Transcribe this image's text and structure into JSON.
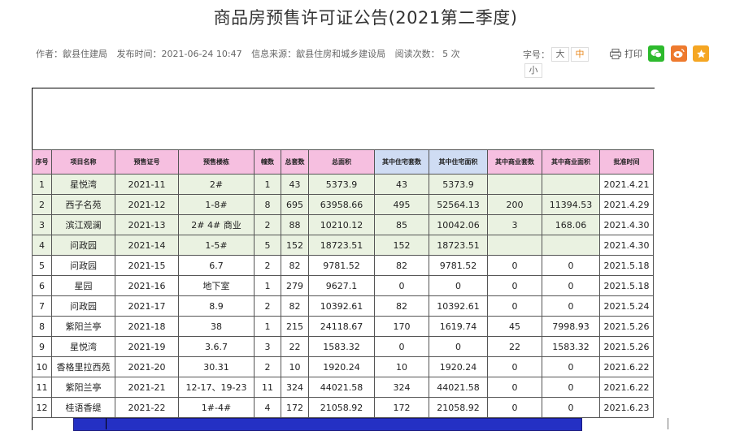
{
  "page": {
    "title": "商品房预售许可证公告(2021第二季度)",
    "meta": {
      "author": "作者：歙县住建局",
      "published": "发布时间：2021-06-24 10:47",
      "source": "信息来源：歙县住房和城乡建设局",
      "reads": "阅读次数： 5 次"
    },
    "font_size": {
      "label": "字号：",
      "large": "大",
      "medium": "中",
      "small": "小"
    },
    "print_label": "打印"
  },
  "colors": {
    "header_pink": "#f6bfe0",
    "header_blue": "#cfdcf3",
    "row_green": "#eaf2e1",
    "accent": "#e8861a"
  },
  "table": {
    "headers": [
      "序号",
      "项目名称",
      "预售证号",
      "预售楼栋",
      "幢数",
      "总套数",
      "总面积",
      "其中住宅套数",
      "其中住宅面积",
      "其中商业套数",
      "其中商业面积",
      "批准时间"
    ],
    "rows": [
      [
        "1",
        "星悦湾",
        "2021-11",
        "2#",
        "1",
        "43",
        "5373.9",
        "43",
        "5373.9",
        "",
        "",
        "2021.4.21"
      ],
      [
        "2",
        "西子名苑",
        "2021-12",
        "1-8#",
        "8",
        "695",
        "63958.66",
        "495",
        "52564.13",
        "200",
        "11394.53",
        "2021.4.29"
      ],
      [
        "3",
        "滨江观澜",
        "2021-13",
        "2# 4# 商业",
        "2",
        "88",
        "10210.12",
        "85",
        "10042.06",
        "3",
        "168.06",
        "2021.4.30"
      ],
      [
        "4",
        "问政园",
        "2021-14",
        "1-5#",
        "5",
        "152",
        "18723.51",
        "152",
        "18723.51",
        "",
        "",
        "2021.4.30"
      ],
      [
        "5",
        "问政园",
        "2021-15",
        "6.7",
        "2",
        "82",
        "9781.52",
        "82",
        "9781.52",
        "0",
        "0",
        "2021.5.18"
      ],
      [
        "6",
        "星园",
        "2021-16",
        "地下室",
        "1",
        "279",
        "9627.1",
        "0",
        "0",
        "0",
        "0",
        "2021.5.18"
      ],
      [
        "7",
        "问政园",
        "2021-17",
        "8.9",
        "2",
        "82",
        "10392.61",
        "82",
        "10392.61",
        "0",
        "0",
        "2021.5.24"
      ],
      [
        "8",
        "紫阳兰亭",
        "2021-18",
        "38",
        "1",
        "215",
        "24118.67",
        "170",
        "1619.74",
        "45",
        "7998.93",
        "2021.5.26"
      ],
      [
        "9",
        "星悦湾",
        "2021-19",
        "3.6.7",
        "3",
        "22",
        "1583.32",
        "0",
        "0",
        "22",
        "1583.32",
        "2021.5.26"
      ],
      [
        "10",
        "香格里拉西苑",
        "2021-20",
        "30.31",
        "2",
        "10",
        "1920.24",
        "10",
        "1920.24",
        "0",
        "0",
        "2021.6.22"
      ],
      [
        "11",
        "紫阳兰亭",
        "2021-21",
        "12-17、19-23",
        "11",
        "324",
        "44021.58",
        "324",
        "44021.58",
        "0",
        "0",
        "2021.6.22"
      ],
      [
        "12",
        "桂语香缇",
        "2021-22",
        "1#-4#",
        "4",
        "172",
        "21058.92",
        "172",
        "21058.92",
        "0",
        "0",
        "2021.6.23"
      ]
    ]
  }
}
